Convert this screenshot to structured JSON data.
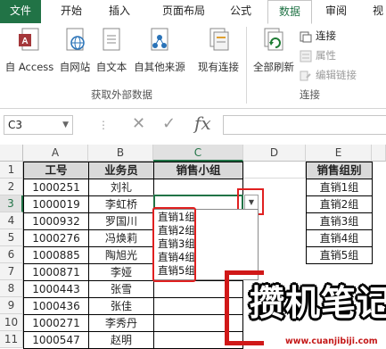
{
  "tabs": {
    "file": "文件",
    "home": "开始",
    "insert": "插入",
    "page_layout": "页面布局",
    "formulas": "公式",
    "data": "数据",
    "review": "审阅",
    "view": "视"
  },
  "ribbon": {
    "from_access": "自 Access",
    "from_web": "自网站",
    "from_text": "自文本",
    "from_other": "自其他来源",
    "existing": "现有连接",
    "refresh_all": "全部刷新",
    "connections": "连接",
    "properties": "属性",
    "edit_links": "编辑链接",
    "group_external": "获取外部数据",
    "group_connections": "连接"
  },
  "formula_bar": {
    "name_box": "C3",
    "fx": "fx",
    "formula": ""
  },
  "grid": {
    "columns": [
      "A",
      "B",
      "C",
      "D",
      "E"
    ],
    "rows": [
      "1",
      "2",
      "3",
      "4",
      "5",
      "6",
      "7",
      "8",
      "9",
      "10",
      "11"
    ],
    "headers": {
      "id": "工号",
      "salesperson": "业务员",
      "group": "销售小组",
      "group_list": "销售组别"
    },
    "ids": [
      "1000251",
      "1000019",
      "1000932",
      "1000276",
      "1000885",
      "1000871",
      "1000443",
      "1000436",
      "1000271",
      "1000547"
    ],
    "names": [
      "刘礼",
      "李虹桥",
      "罗国川",
      "冯焕莉",
      "陶旭光",
      "李娅",
      "张雪",
      "张佳",
      "李秀丹",
      "赵明"
    ],
    "group_list": [
      "直销1组",
      "直销2组",
      "直销3组",
      "直销4组",
      "直销5组"
    ]
  },
  "dropdown": {
    "options": [
      "直销1组",
      "直销2组",
      "直销3组",
      "直销4组",
      "直销5组"
    ]
  },
  "watermark": {
    "brand": "攒机笔记",
    "url": "www.cuanjibiji.com"
  },
  "colors": {
    "excel_green": "#217346",
    "highlight_red": "#e02020",
    "header_gray": "#d9d9d9"
  }
}
